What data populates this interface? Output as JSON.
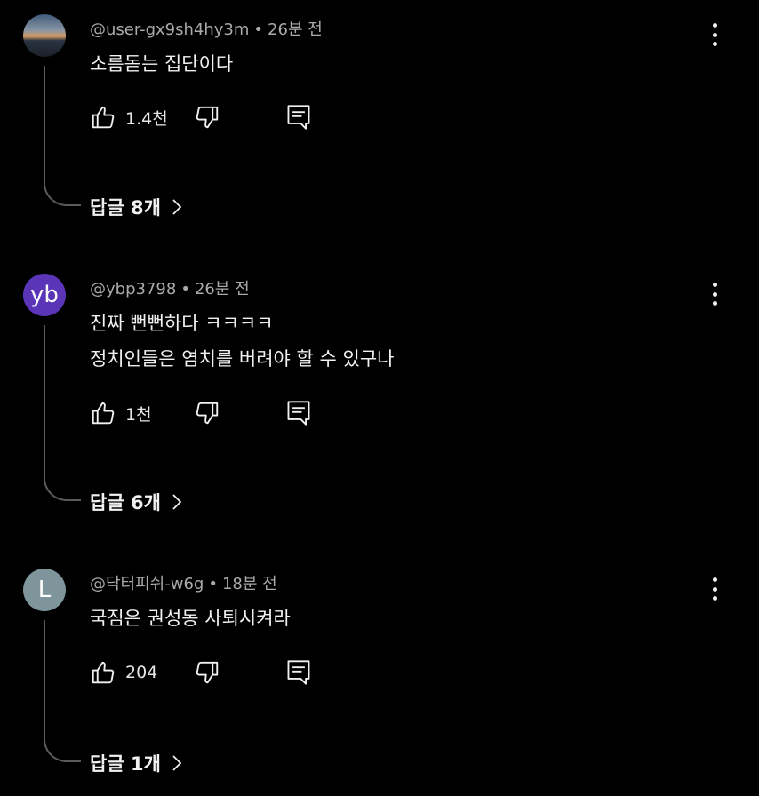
{
  "comments": [
    {
      "author": "@user-gx9sh4hy3m",
      "time": "26분 전",
      "lines": [
        "소름돋는 집단이다"
      ],
      "likes": "1.4천",
      "replies": "답글 8개",
      "avatar_text": ""
    },
    {
      "author": "@ybp3798",
      "time": "26분 전",
      "lines": [
        "진짜 뻔뻔하다 ㅋㅋㅋㅋ",
        "정치인들은 염치를 버려야 할 수 있구나"
      ],
      "likes": "1천",
      "replies": "답글 6개",
      "avatar_text": "yb"
    },
    {
      "author": "@닥터피쉬-w6g",
      "time": "18분 전",
      "lines": [
        "국짐은 권성동 사퇴시켜라"
      ],
      "likes": "204",
      "replies": "답글 1개",
      "avatar_text": "L"
    }
  ],
  "separator": "•",
  "icons": {
    "like": "thumbs-up-icon",
    "dislike": "thumbs-down-icon",
    "reply": "comment-reply-icon",
    "more": "more-vertical-icon",
    "chevron": "chevron-right-icon"
  },
  "colors": {
    "background": "#000000",
    "text": "#f1f1f1",
    "meta": "#aaaaaa",
    "avatar_yb": "#5a35b8",
    "avatar_l": "#7e959c"
  }
}
